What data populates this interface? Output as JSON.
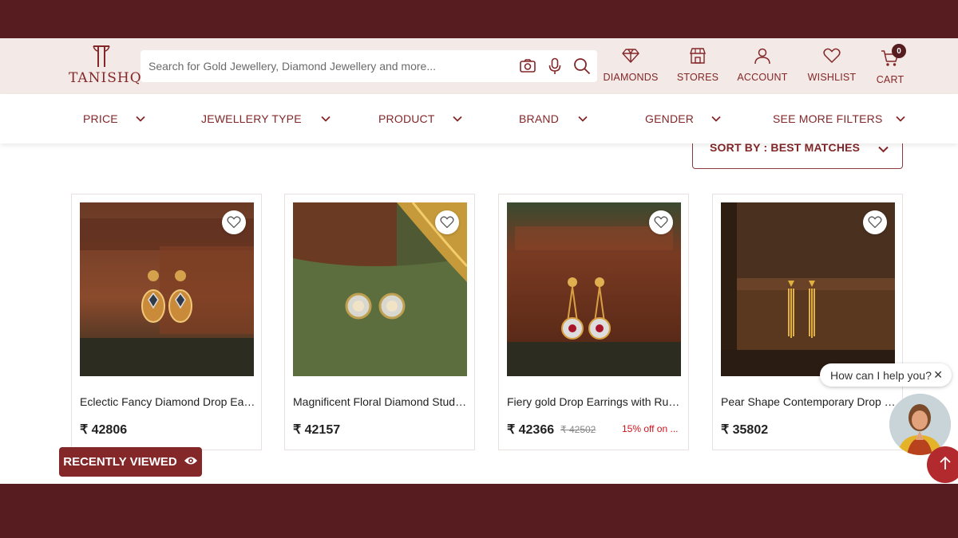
{
  "brand": {
    "name": "TANISHQ",
    "color": "#832729",
    "dark": "#571c1f"
  },
  "search": {
    "placeholder": "Search for Gold Jewellery, Diamond Jewellery and more..."
  },
  "header_nav": [
    {
      "label": "DIAMONDS",
      "icon": "diamond-icon"
    },
    {
      "label": "STORES",
      "icon": "store-icon"
    },
    {
      "label": "ACCOUNT",
      "icon": "user-icon"
    },
    {
      "label": "WISHLIST",
      "icon": "heart-icon"
    },
    {
      "label": "CART",
      "icon": "cart-icon"
    }
  ],
  "cart_count": "0",
  "filters": [
    "PRICE",
    "JEWELLERY TYPE",
    "PRODUCT",
    "BRAND",
    "GENDER",
    "SEE MORE FILTERS"
  ],
  "sort": {
    "label": "SORT BY : BEST MATCHES"
  },
  "products": [
    {
      "title": "Eclectic Fancy Diamond Drop Earri...",
      "price": "₹ 42806"
    },
    {
      "title": "Magnificent Floral Diamond Stud E...",
      "price": "₹ 42157"
    },
    {
      "title": "Fiery gold Drop Earrings with Rubi...",
      "price": "₹ 42366",
      "mrp": "₹ 42502",
      "discount": "15% off on ..."
    },
    {
      "title": "Pear Shape Contemporary Drop E...",
      "price": "₹ 35802"
    }
  ],
  "recently_viewed": {
    "label": "RECENTLY VIEWED",
    "icon": "eye-icon"
  },
  "help": {
    "text": "How can I help you?",
    "close": "✕"
  }
}
